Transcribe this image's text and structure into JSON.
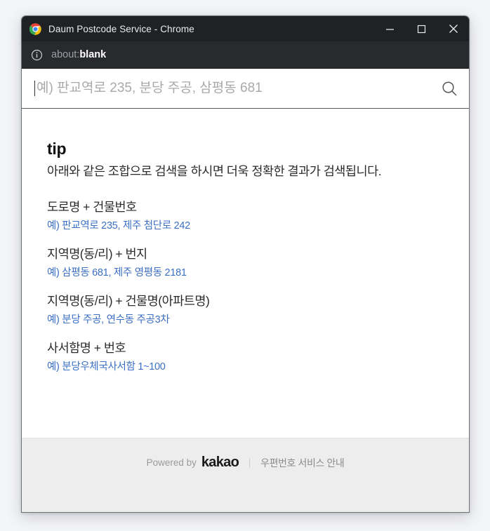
{
  "window": {
    "title": "Daum Postcode Service - Chrome",
    "logo_icon": "chrome-logo-icon",
    "controls": {
      "minimize": "minimize-icon",
      "maximize": "maximize-icon",
      "close": "close-icon"
    }
  },
  "address_bar": {
    "info_icon": "info-circle-icon",
    "url_prefix": "about:",
    "url_page": "blank"
  },
  "search": {
    "placeholder": "예) 판교역로 235, 분당 주공, 삼평동 681",
    "value": "",
    "icon": "search-icon"
  },
  "tip": {
    "heading": "tip",
    "description": "아래와 같은 조합으로 검색을 하시면 더욱 정확한 결과가 검색됩니다.",
    "items": [
      {
        "title": "도로명 + 건물번호",
        "example": "예) 판교역로 235,  제주 첨단로 242"
      },
      {
        "title": "지역명(동/리) + 번지",
        "example": "예) 삼평동 681,  제주 영평동 2181"
      },
      {
        "title": "지역명(동/리) + 건물명(아파트명)",
        "example": "예) 분당 주공,  연수동 주공3차"
      },
      {
        "title": "사서함명 + 번호",
        "example": "예) 분당우체국사서함 1~100"
      }
    ]
  },
  "footer": {
    "powered_by": "Powered by",
    "brand": "kakao",
    "link": "우편번호 서비스 안내"
  },
  "colors": {
    "titlebar_bg": "#202124",
    "addressbar_bg": "#292a2d",
    "link_blue": "#3b6fc4",
    "footer_bg": "#ededed",
    "page_bg": "#f4f5f8"
  }
}
